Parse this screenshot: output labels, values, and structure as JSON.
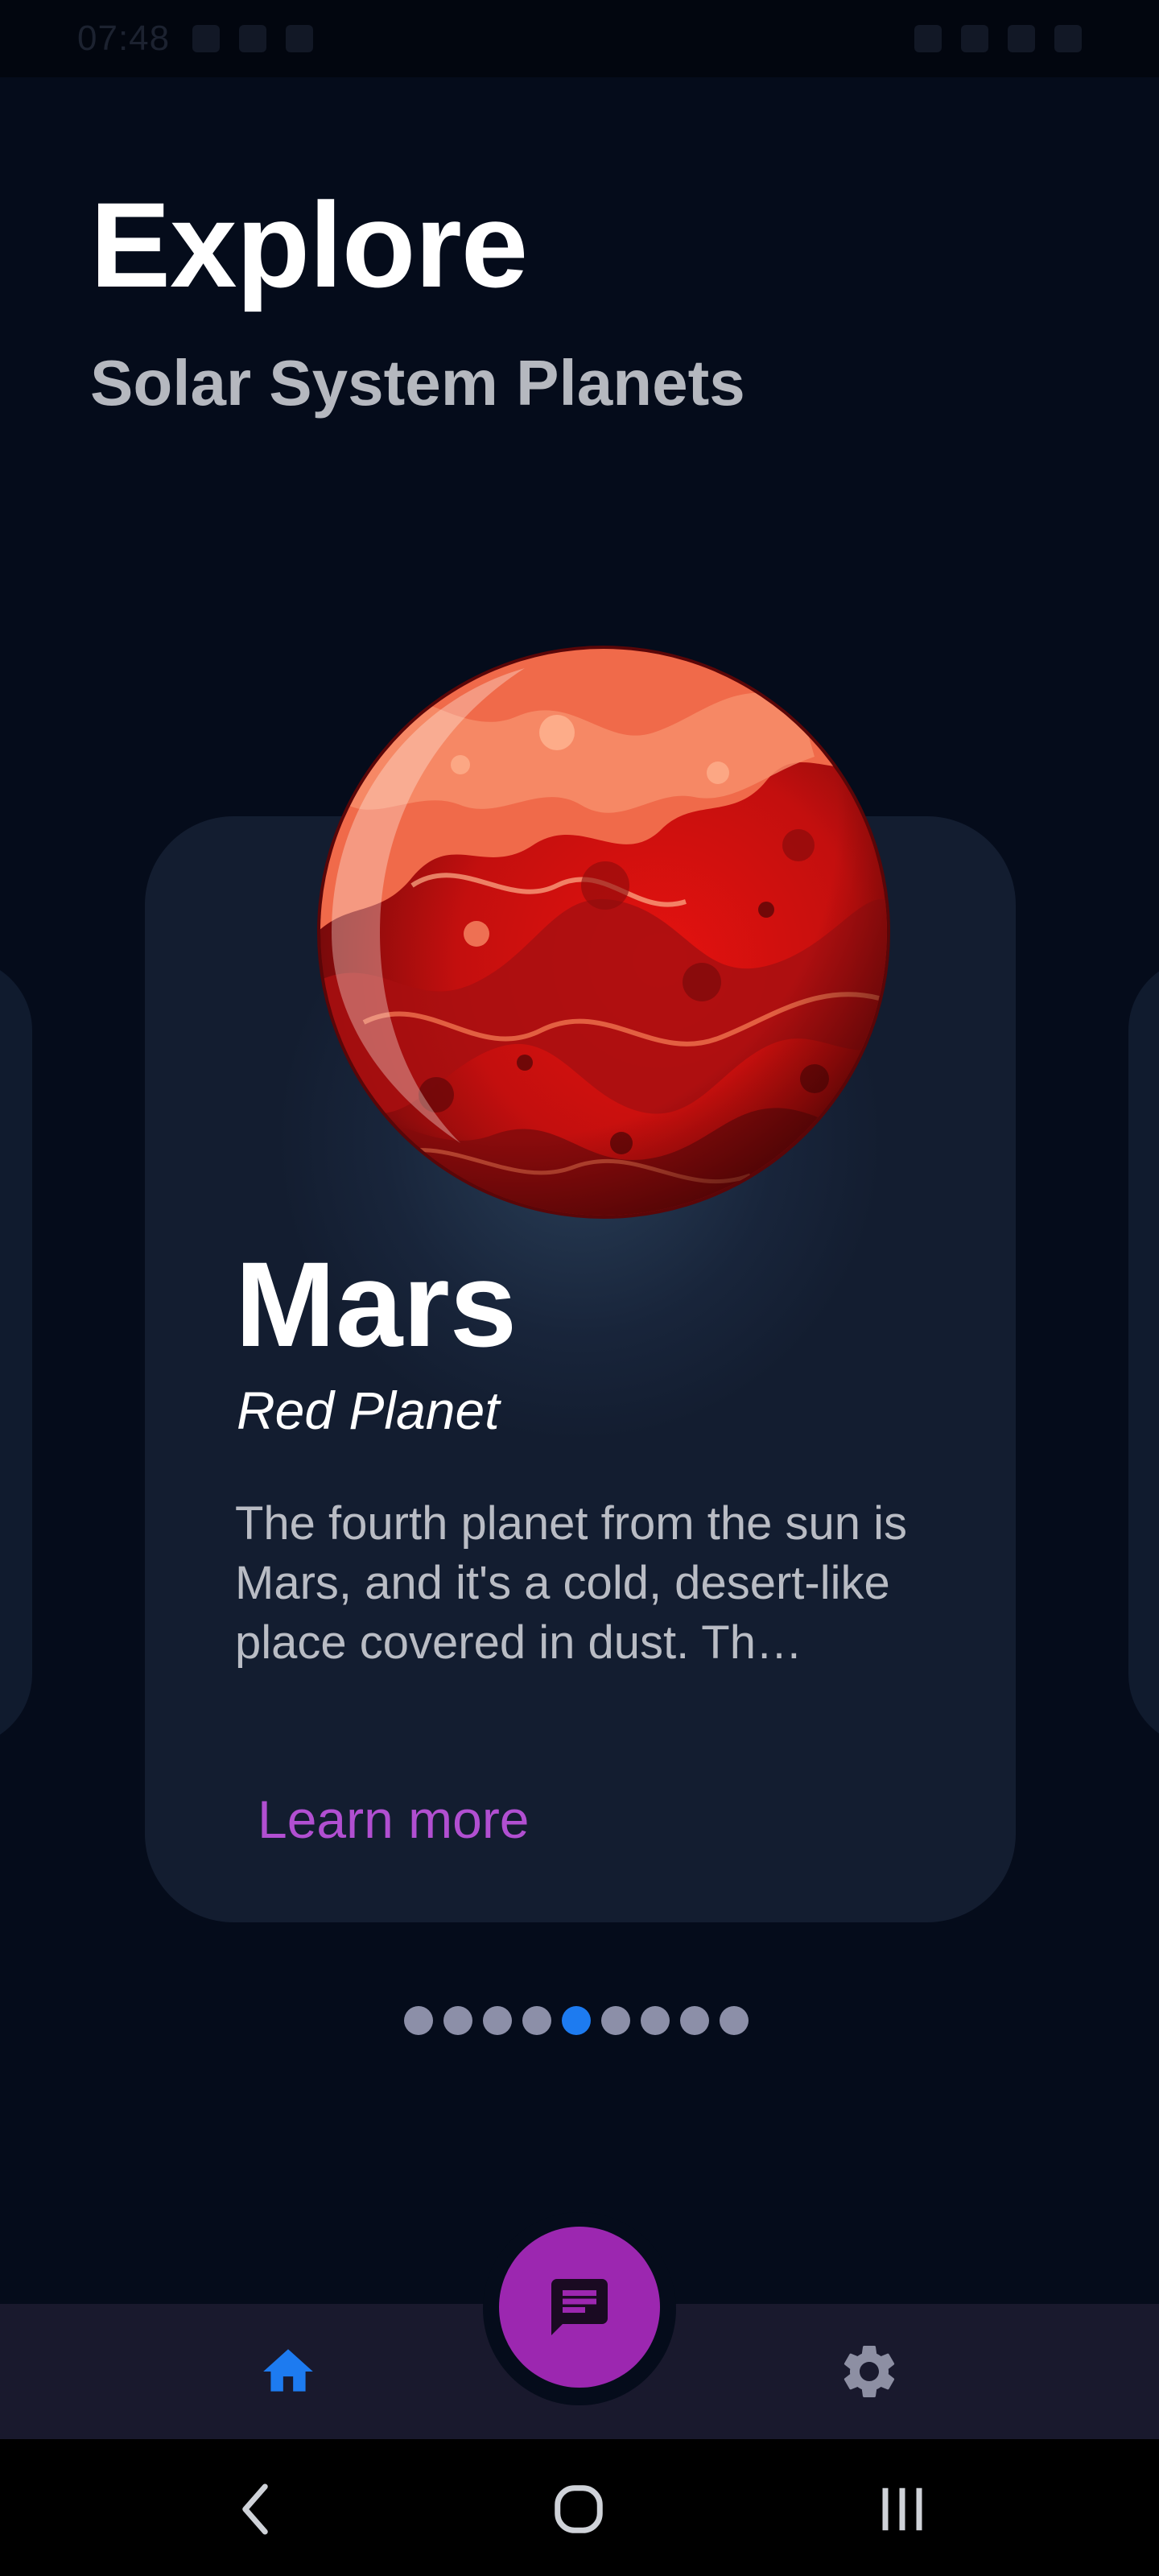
{
  "status_bar": {
    "time": "07:48"
  },
  "header": {
    "title": "Explore",
    "subtitle": "Solar System Planets"
  },
  "card": {
    "name": "Mars",
    "nickname": "Red Planet",
    "description": "The fourth planet from the sun is Mars, and it's a cold, desert-like place covered in dust. Th…",
    "action_label": "Learn more",
    "planet_icon": "mars-planet-image"
  },
  "pagination": {
    "total": 9,
    "active_index": 4
  },
  "bottom_nav": {
    "items": [
      {
        "icon": "home-icon",
        "active": true
      },
      {
        "icon": "chat-icon",
        "fab": true
      },
      {
        "icon": "gear-icon",
        "active": false
      }
    ]
  },
  "system_nav": {
    "items": [
      "back-icon",
      "home-circle-icon",
      "recents-icon"
    ]
  },
  "colors": {
    "background": "#050c1b",
    "card": "#131d30",
    "accent_purple": "#9c27b0",
    "link_purple": "#b14fd1",
    "active_blue": "#1d7bf0",
    "dot_inactive": "#8c8fa8",
    "nav_bar": "#19192d"
  }
}
